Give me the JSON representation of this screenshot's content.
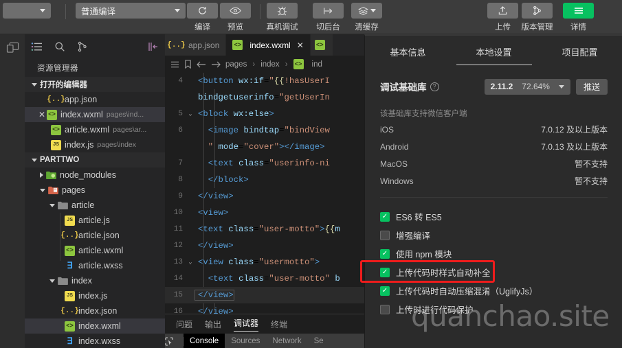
{
  "toolbar": {
    "project_select": {
      "value": "",
      "caret": "chevron-down-icon"
    },
    "compile_mode": {
      "value": "普通编译",
      "caret": "chevron-down-icon"
    },
    "buttons": [
      {
        "name": "compile",
        "label": "编译",
        "icon": "refresh-icon"
      },
      {
        "name": "preview",
        "label": "预览",
        "icon": "eye-icon"
      },
      {
        "name": "real-device-debug",
        "label": "真机调试",
        "icon": "bug-icon"
      },
      {
        "name": "switch-background",
        "label": "切后台",
        "icon": "arrow-to-line-icon"
      },
      {
        "name": "clear-cache",
        "label": "清缓存",
        "icon": "layers-icon"
      },
      {
        "name": "upload",
        "label": "上传",
        "icon": "upload-icon"
      },
      {
        "name": "version-manage",
        "label": "版本管理",
        "icon": "branch-icon"
      },
      {
        "name": "details",
        "label": "详情",
        "icon": "hamburger-icon"
      }
    ],
    "accent_green": "#07c160"
  },
  "activitybar": {
    "icons": [
      "simulator-icon"
    ]
  },
  "sidebar": {
    "toolbar_icons": [
      "explorer-icon",
      "search-icon",
      "source-control-icon",
      "collapse-panel-icon"
    ],
    "title": "资源管理器",
    "open_editors": {
      "label": "打开的编辑器",
      "items": [
        {
          "name": "app.json",
          "icon": "json-icon",
          "path": "",
          "closable": false,
          "selected": false
        },
        {
          "name": "index.wxml",
          "icon": "wxml-icon",
          "path": "pages\\ind...",
          "closable": true,
          "selected": true
        },
        {
          "name": "article.wxml",
          "icon": "wxml-icon",
          "path": "pages\\ar...",
          "closable": false,
          "selected": false
        },
        {
          "name": "index.js",
          "icon": "js-icon",
          "path": "pages\\index",
          "closable": false,
          "selected": false
        }
      ]
    },
    "project": {
      "label": "PARTTWO",
      "items": [
        {
          "label": "node_modules",
          "icon": "folder-node-icon",
          "indent": 1,
          "expander": "right",
          "selected": false
        },
        {
          "label": "pages",
          "icon": "folder-pages-icon",
          "indent": 1,
          "expander": "down",
          "selected": false
        },
        {
          "label": "article",
          "icon": "folder-icon",
          "indent": 2,
          "expander": "down",
          "selected": false
        },
        {
          "label": "article.js",
          "icon": "js-icon",
          "indent": 3,
          "expander": "none",
          "selected": false
        },
        {
          "label": "article.json",
          "icon": "json-icon",
          "indent": 3,
          "expander": "none",
          "selected": false
        },
        {
          "label": "article.wxml",
          "icon": "wxml-icon",
          "indent": 3,
          "expander": "none",
          "selected": false
        },
        {
          "label": "article.wxss",
          "icon": "wxss-icon",
          "indent": 3,
          "expander": "none",
          "selected": false
        },
        {
          "label": "index",
          "icon": "folder-icon",
          "indent": 2,
          "expander": "down",
          "selected": false
        },
        {
          "label": "index.js",
          "icon": "js-icon",
          "indent": 3,
          "expander": "none",
          "selected": false
        },
        {
          "label": "index.json",
          "icon": "json-icon",
          "indent": 3,
          "expander": "none",
          "selected": false
        },
        {
          "label": "index.wxml",
          "icon": "wxml-icon",
          "indent": 3,
          "expander": "none",
          "selected": true
        },
        {
          "label": "index.wxss",
          "icon": "wxss-icon",
          "indent": 3,
          "expander": "none",
          "selected": false
        }
      ]
    }
  },
  "editor": {
    "tabs": [
      {
        "label": "app.json",
        "icon": "json-icon",
        "active": false,
        "closable": false
      },
      {
        "label": "index.wxml",
        "icon": "wxml-icon",
        "active": true,
        "closable": true
      },
      {
        "label": "",
        "icon": "wxml-icon",
        "active": false,
        "closable": false
      }
    ],
    "breadcrumb": {
      "icons": [
        "outline-icon",
        "bookmark-icon",
        "back-arrow-icon",
        "forward-arrow-icon"
      ],
      "parts": [
        "pages",
        "index",
        "ind"
      ]
    },
    "lines": [
      {
        "no": "4",
        "fold": "",
        "text": "<button wx:if=\"{{!hasUserI",
        "highlight": false
      },
      {
        "no": "",
        "fold": "",
        "text": "bindgetuserinfo=\"getUserIn",
        "highlight": false
      },
      {
        "no": "5",
        "fold": "v",
        "text": "<block wx:else>",
        "highlight": false
      },
      {
        "no": "6",
        "fold": "",
        "text": "  <image bindtap=\"bindView",
        "highlight": false
      },
      {
        "no": "",
        "fold": "",
        "text": "  \" mode=\"cover\"></image>",
        "highlight": false
      },
      {
        "no": "7",
        "fold": "",
        "text": "  <text class=\"userinfo-ni",
        "highlight": false
      },
      {
        "no": "8",
        "fold": "",
        "text": "  </block>",
        "highlight": false
      },
      {
        "no": "9",
        "fold": "",
        "text": "</view>",
        "highlight": false
      },
      {
        "no": "10",
        "fold": "",
        "text": "<view>",
        "highlight": false
      },
      {
        "no": "11",
        "fold": "",
        "text": "<text class=\"user-motto\">{{m",
        "highlight": false
      },
      {
        "no": "12",
        "fold": "",
        "text": "</view>",
        "highlight": false
      },
      {
        "no": "13",
        "fold": "v",
        "text": "<view class=\"usermotto\">",
        "highlight": false
      },
      {
        "no": "14",
        "fold": "",
        "text": "  <text class=\"user-motto\" b",
        "highlight": false
      },
      {
        "no": "15",
        "fold": "",
        "text": "</view>",
        "highlight": true
      },
      {
        "no": "16",
        "fold": "",
        "text": "</view>",
        "highlight": false
      }
    ]
  },
  "panel": {
    "tabs": [
      {
        "label": "问题",
        "active": false
      },
      {
        "label": "输出",
        "active": false
      },
      {
        "label": "调试器",
        "active": true
      },
      {
        "label": "终端",
        "active": false
      }
    ],
    "devtools": {
      "inspect_icon": "cursor-select-icon",
      "tabs": [
        {
          "label": "Console",
          "active": true
        },
        {
          "label": "Sources",
          "active": false
        },
        {
          "label": "Network",
          "active": false
        },
        {
          "label": "Se",
          "active": false
        }
      ]
    }
  },
  "detail": {
    "tabs": [
      {
        "label": "基本信息",
        "active": false
      },
      {
        "label": "本地设置",
        "active": true
      },
      {
        "label": "项目配置",
        "active": false
      }
    ],
    "debug_library": {
      "title": "调试基础库",
      "help_icon": "question-circle-icon",
      "version": "2.11.2",
      "coverage": "72.64%",
      "caret": "chevron-down-icon",
      "push_label": "推送",
      "note": "该基础库支持微信客户端",
      "platforms": [
        {
          "name": "iOS",
          "value": "7.0.12 及以上版本"
        },
        {
          "name": "Android",
          "value": "7.0.13 及以上版本"
        },
        {
          "name": "MacOS",
          "value": "暂不支持"
        },
        {
          "name": "Windows",
          "value": "暂不支持"
        }
      ]
    },
    "checkboxes": [
      {
        "label": "ES6 转 ES5",
        "checked": true,
        "highlighted": false
      },
      {
        "label": "增强编译",
        "checked": false,
        "highlighted": false
      },
      {
        "label": "使用 npm 模块",
        "checked": true,
        "highlighted": true
      },
      {
        "label": "上传代码时样式自动补全",
        "checked": true,
        "highlighted": false
      },
      {
        "label": "上传代码时自动压缩混淆（UglifyJs）",
        "checked": true,
        "highlighted": false
      },
      {
        "label": "上传时进行代码保护",
        "checked": false,
        "highlighted": false
      }
    ],
    "highlight_color": "#ee1c1c"
  },
  "watermark": {
    "text": "quanchao.site"
  }
}
